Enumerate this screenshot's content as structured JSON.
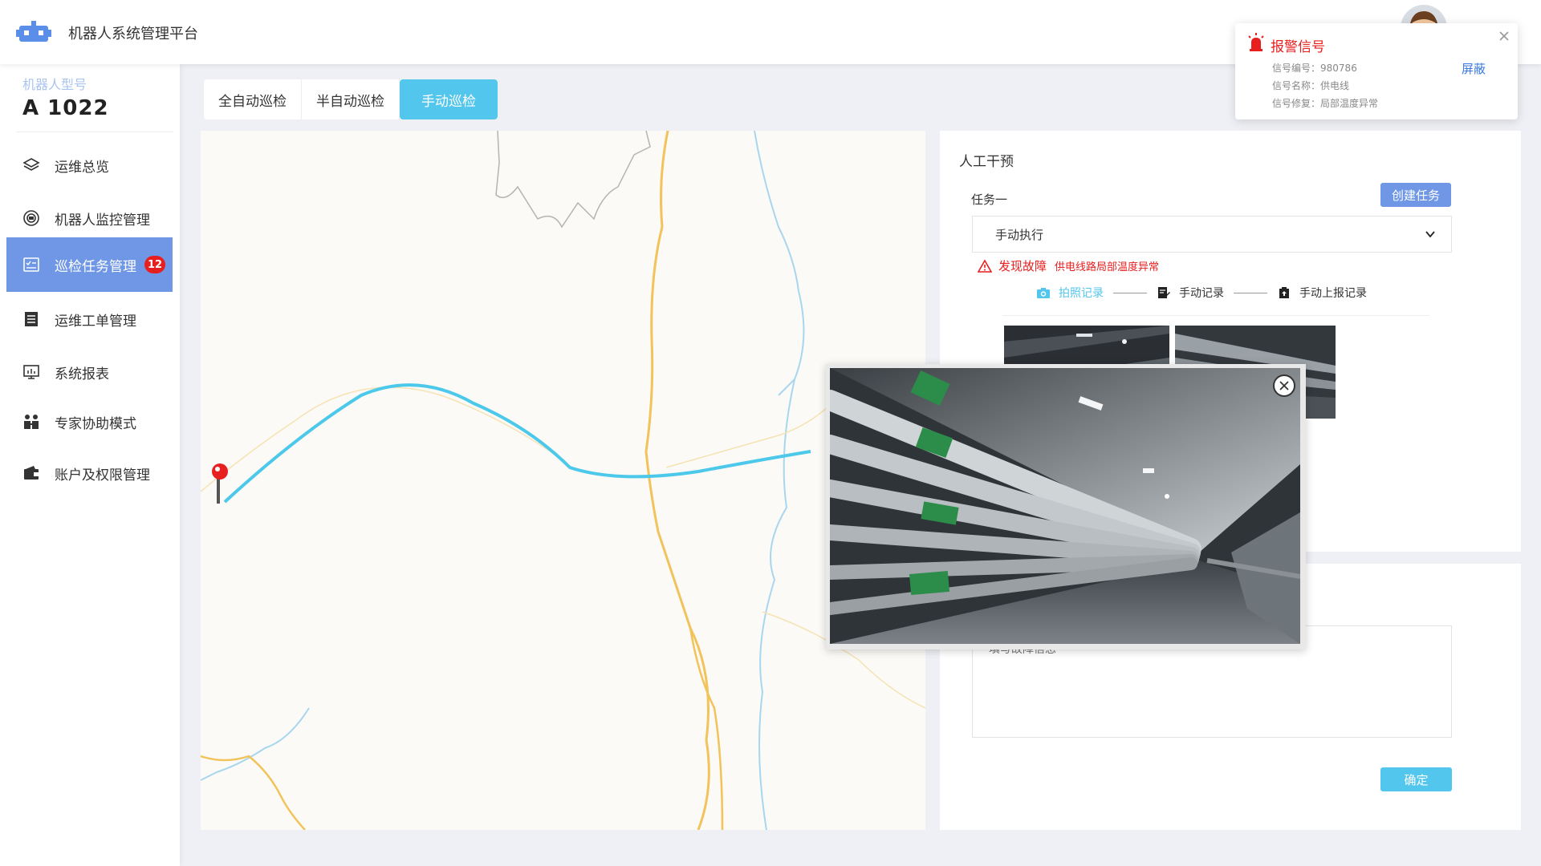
{
  "app": {
    "title": "机器人系统管理平台"
  },
  "sidebar": {
    "model_label": "机器人型号",
    "model_value": "A 1022",
    "items": [
      {
        "label": "运维总览",
        "icon": "layers-icon"
      },
      {
        "label": "机器人监控管理",
        "icon": "monitor-circle-icon"
      },
      {
        "label": "巡检任务管理",
        "icon": "task-list-icon",
        "badge": "12",
        "active": true
      },
      {
        "label": "运维工单管理",
        "icon": "work-order-icon"
      },
      {
        "label": "系统报表",
        "icon": "report-screen-icon"
      },
      {
        "label": "专家协助模式",
        "icon": "expert-icon"
      },
      {
        "label": "账户及权限管理",
        "icon": "wallet-icon"
      }
    ]
  },
  "tabs": [
    {
      "label": "全自动巡检",
      "active": false
    },
    {
      "label": "半自动巡检",
      "active": false
    },
    {
      "label": "手动巡检",
      "active": true
    }
  ],
  "right_panel": {
    "title": "人工干预",
    "task_label": "任务一",
    "create_task_label": "创建任务",
    "select_value": "手动执行",
    "fault_title": "发现故障",
    "fault_detail": "供电线路局部温度异常",
    "steps": [
      {
        "label": "拍照记录",
        "icon": "camera-icon",
        "active": true
      },
      {
        "label": "手动记录",
        "icon": "edit-doc-icon",
        "active": false
      },
      {
        "label": "手动上报记录",
        "icon": "upload-record-icon",
        "active": false
      }
    ],
    "fault_placeholder": "填写故障信息",
    "confirm_label": "确定"
  },
  "alarm": {
    "title": "报警信号",
    "number_label": "信号编号：",
    "number_value": "980786",
    "name_label": "信号名称：",
    "name_value": "供电线",
    "repair_label": "信号修复：",
    "repair_value": "局部温度异常",
    "shield_label": "屏蔽"
  },
  "colors": {
    "accent_blue": "#6f97e6",
    "accent_cyan": "#52c6ec",
    "alert_red": "#e81f1f"
  }
}
